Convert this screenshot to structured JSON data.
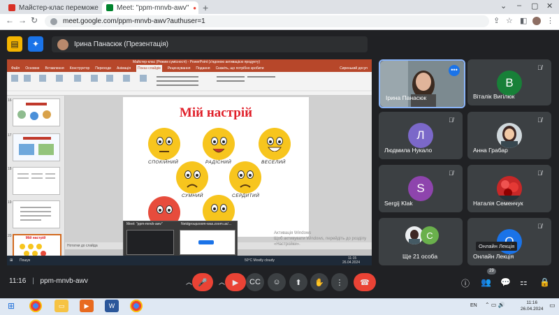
{
  "browser": {
    "tabs": [
      {
        "title": "Майстер-клас переможе обл...",
        "icon_color": "#d93025"
      },
      {
        "title": "Meet: \"ppm-mnvb-awv\"",
        "icon_color": "#00832d"
      }
    ],
    "url": "meet.google.com/ppm-mnvb-awv?authuser=1",
    "new_tab": "+",
    "window_controls": [
      "⌄",
      "–",
      "▢",
      "✕"
    ]
  },
  "meet": {
    "presenter_label": "Ірина Панасюк (Презентація)",
    "meeting_code": "ppm-mnvb-awv",
    "time": "11:16",
    "participant_count": "29",
    "participants": [
      {
        "name": "Ірина Панасюк",
        "initial": "",
        "color": "#6a6f73"
      },
      {
        "name": "Віталік Вигілюк",
        "initial": "В",
        "color": "#188038"
      },
      {
        "name": "Людмила Нукало",
        "initial": "Л",
        "color": "#7b68c9"
      },
      {
        "name": "Анна Грабар",
        "initial": "",
        "color": "#8d6e63"
      },
      {
        "name": "Sergij Klak",
        "initial": "S",
        "color": "#8e44ad"
      },
      {
        "name": "Наталія Семенчук",
        "initial": "",
        "color": "#b71c1c"
      },
      {
        "name": "Ще 21 особа",
        "initial": "С",
        "color": "#6ab04c"
      },
      {
        "name": "Онлайн Лекція",
        "initial": "О",
        "color": "#1a73e8"
      }
    ],
    "tooltip": "Онлайн Лекція"
  },
  "powerpoint": {
    "title_bar": "Майстер-клас (Режим сумісності) - PowerPoint (з'ядоною активацією продукту)",
    "tabs": [
      "Файл",
      "Основне",
      "Вставлення",
      "Конструктор",
      "Переходи",
      "Анімація",
      "Показ слайдів",
      "Рецензування",
      "Подання",
      "Скажіть, що потрібно зробити"
    ],
    "user": "Сиренький досуп",
    "slide_title": "Мій настрій",
    "moods": [
      "спокійний",
      "радісний",
      "веселий",
      "сумний",
      "сердитий"
    ],
    "notes": "Нотатки до слайда",
    "thumb_numbers": [
      "16",
      "17",
      "18",
      "19",
      "20"
    ],
    "thumb_selected_title": "Мій настрій",
    "activation_line1": "Активація Windows",
    "activation_line2": "Щоб активувати Windows, перейдіть до розділу «Настройки».",
    "popup_tabs": [
      "Meet: \"ppm-mnvb-awv\"",
      "Netdgroupzoom-was.zoom.us/..."
    ],
    "inner_taskbar": {
      "search": "Пошук",
      "weather": "50°C Mostly cloudy",
      "time": "11:15",
      "date": "26.04.2024"
    }
  },
  "controls": {
    "mic_icon": "mic-off-icon",
    "camera_icon": "camera-off-icon",
    "captions_icon": "captions-icon",
    "emoji_icon": "emoji-icon",
    "present_icon": "present-icon",
    "hand_icon": "raise-hand-icon",
    "more_icon": "more-icon",
    "leave_icon": "leave-call-icon"
  },
  "system": {
    "lang": "EN",
    "clock_time": "11:16",
    "clock_date": "26.04.2024"
  }
}
